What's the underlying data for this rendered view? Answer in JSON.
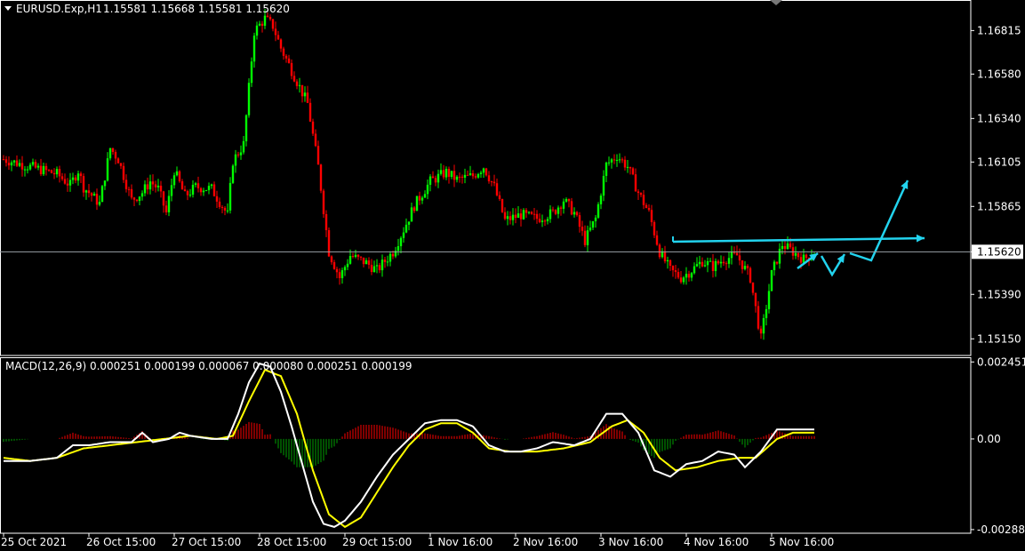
{
  "chart_data": {
    "type": "candlestick",
    "symbol_label": "EURUSD.Exp,H1",
    "ohlc_label": "1.15581 1.15668 1.15581 1.15620",
    "price_axis": {
      "ticks": [
        "1.16815",
        "1.16580",
        "1.16340",
        "1.16105",
        "1.15865",
        "1.15620",
        "1.15390",
        "1.15150"
      ],
      "current_price": "1.15620",
      "ylim": [
        1.1506,
        1.1698
      ]
    },
    "time_axis": {
      "ticks": [
        "25 Oct 2021",
        "26 Oct 15:00",
        "27 Oct 15:00",
        "28 Oct 15:00",
        "29 Oct 15:00",
        "1 Nov 16:00",
        "2 Nov 16:00",
        "3 Nov 16:00",
        "4 Nov 16:00",
        "5 Nov 16:00"
      ]
    },
    "price_path": [
      [
        0,
        1.1612
      ],
      [
        10,
        1.1608
      ],
      [
        20,
        1.1604
      ],
      [
        25,
        1.1598
      ],
      [
        28,
        1.1606
      ],
      [
        30,
        1.1597
      ],
      [
        36,
        1.1588
      ],
      [
        40,
        1.1618
      ],
      [
        43,
        1.1612
      ],
      [
        48,
        1.159
      ],
      [
        52,
        1.1594
      ],
      [
        55,
        1.16
      ],
      [
        58,
        1.1596
      ],
      [
        61,
        1.1583
      ],
      [
        64,
        1.1606
      ],
      [
        68,
        1.1592
      ],
      [
        72,
        1.1597
      ],
      [
        78,
        1.1596
      ],
      [
        84,
        1.1582
      ],
      [
        86,
        1.1611
      ],
      [
        90,
        1.162
      ],
      [
        94,
        1.1681
      ],
      [
        98,
        1.1688
      ],
      [
        101,
        1.1684
      ],
      [
        104,
        1.1672
      ],
      [
        110,
        1.1654
      ],
      [
        114,
        1.1642
      ],
      [
        118,
        1.1608
      ],
      [
        122,
        1.1562
      ],
      [
        126,
        1.1548
      ],
      [
        130,
        1.156
      ],
      [
        136,
        1.1556
      ],
      [
        140,
        1.1552
      ],
      [
        146,
        1.1562
      ],
      [
        150,
        1.1574
      ],
      [
        154,
        1.1587
      ],
      [
        160,
        1.16
      ],
      [
        166,
        1.1605
      ],
      [
        170,
        1.1601
      ],
      [
        176,
        1.1603
      ],
      [
        180,
        1.1608
      ],
      [
        184,
        1.1597
      ],
      [
        188,
        1.1579
      ],
      [
        194,
        1.1582
      ],
      [
        200,
        1.158
      ],
      [
        206,
        1.1583
      ],
      [
        210,
        1.159
      ],
      [
        214,
        1.1583
      ],
      [
        218,
        1.1568
      ],
      [
        222,
        1.158
      ],
      [
        226,
        1.1609
      ],
      [
        230,
        1.1614
      ],
      [
        234,
        1.1608
      ],
      [
        238,
        1.1594
      ],
      [
        242,
        1.1583
      ],
      [
        246,
        1.1562
      ],
      [
        250,
        1.1552
      ],
      [
        254,
        1.1548
      ],
      [
        258,
        1.1552
      ],
      [
        262,
        1.1557
      ],
      [
        266,
        1.1554
      ],
      [
        270,
        1.1558
      ],
      [
        275,
        1.156
      ],
      [
        280,
        1.1548
      ],
      [
        284,
        1.1515
      ],
      [
        288,
        1.155
      ],
      [
        292,
        1.1566
      ],
      [
        296,
        1.1562
      ],
      [
        300,
        1.1558
      ],
      [
        304,
        1.1562
      ]
    ],
    "forecast_arrows": "cyan",
    "colors": {
      "bull": "#00ff00",
      "bear": "#ff0000",
      "macd_line": "#ffffff",
      "signal_line": "#ffff00",
      "hist_pos": "#ff0000",
      "hist_neg": "#00a000",
      "arrows": "#22d3ee",
      "grid": "#ffffff"
    },
    "macd": {
      "label": "MACD(12,26,9) 0.000251 0.000199 0.000067 0.000080 0.000251 0.000199",
      "ticks": [
        "0.002451",
        "0.00",
        "-0.002884"
      ],
      "ylim": [
        -0.003,
        0.0026
      ],
      "macd_line": [
        [
          0,
          -0.0007
        ],
        [
          10,
          -0.0007
        ],
        [
          20,
          -0.0006
        ],
        [
          26,
          -0.0002
        ],
        [
          32,
          -0.0002
        ],
        [
          40,
          -0.0001
        ],
        [
          48,
          -0.0001
        ],
        [
          52,
          0.0002
        ],
        [
          56,
          -0.0001
        ],
        [
          62,
          0.0
        ],
        [
          66,
          0.0002
        ],
        [
          70,
          0.0001
        ],
        [
          78,
          0.0
        ],
        [
          84,
          0.0
        ],
        [
          88,
          0.0008
        ],
        [
          92,
          0.0018
        ],
        [
          96,
          0.0024
        ],
        [
          100,
          0.0023
        ],
        [
          104,
          0.0015
        ],
        [
          108,
          0.0004
        ],
        [
          112,
          -0.0008
        ],
        [
          116,
          -0.002
        ],
        [
          120,
          -0.0027
        ],
        [
          124,
          -0.0028
        ],
        [
          128,
          -0.0026
        ],
        [
          134,
          -0.002
        ],
        [
          140,
          -0.0012
        ],
        [
          146,
          -0.0005
        ],
        [
          152,
          0.0
        ],
        [
          158,
          0.0005
        ],
        [
          164,
          0.0006
        ],
        [
          170,
          0.0006
        ],
        [
          176,
          0.0004
        ],
        [
          182,
          -0.0002
        ],
        [
          188,
          -0.0004
        ],
        [
          194,
          -0.0004
        ],
        [
          200,
          -0.0003
        ],
        [
          206,
          -0.0001
        ],
        [
          214,
          -0.0002
        ],
        [
          220,
          0.0
        ],
        [
          226,
          0.0008
        ],
        [
          232,
          0.0008
        ],
        [
          238,
          0.0002
        ],
        [
          244,
          -0.001
        ],
        [
          250,
          -0.0012
        ],
        [
          256,
          -0.0008
        ],
        [
          262,
          -0.0007
        ],
        [
          268,
          -0.0004
        ],
        [
          274,
          -0.0005
        ],
        [
          278,
          -0.0009
        ],
        [
          284,
          -0.0004
        ],
        [
          290,
          0.0003
        ],
        [
          296,
          0.0003
        ],
        [
          304,
          0.0003
        ]
      ],
      "signal_line": [
        [
          0,
          -0.0006
        ],
        [
          10,
          -0.0007
        ],
        [
          20,
          -0.0006
        ],
        [
          30,
          -0.0003
        ],
        [
          40,
          -0.0002
        ],
        [
          50,
          -0.0001
        ],
        [
          60,
          0.0
        ],
        [
          70,
          0.0001
        ],
        [
          80,
          0.0
        ],
        [
          86,
          0.0001
        ],
        [
          92,
          0.0012
        ],
        [
          98,
          0.0022
        ],
        [
          104,
          0.002
        ],
        [
          110,
          0.0008
        ],
        [
          116,
          -0.001
        ],
        [
          122,
          -0.0024
        ],
        [
          128,
          -0.0028
        ],
        [
          134,
          -0.0025
        ],
        [
          140,
          -0.0017
        ],
        [
          146,
          -0.0009
        ],
        [
          152,
          -0.0002
        ],
        [
          158,
          0.0003
        ],
        [
          164,
          0.0005
        ],
        [
          170,
          0.0005
        ],
        [
          176,
          0.0002
        ],
        [
          182,
          -0.0003
        ],
        [
          190,
          -0.0004
        ],
        [
          200,
          -0.0004
        ],
        [
          210,
          -0.0003
        ],
        [
          220,
          -0.0001
        ],
        [
          228,
          0.0004
        ],
        [
          234,
          0.0006
        ],
        [
          240,
          0.0002
        ],
        [
          246,
          -0.0006
        ],
        [
          252,
          -0.001
        ],
        [
          260,
          -0.0009
        ],
        [
          268,
          -0.0007
        ],
        [
          276,
          -0.0006
        ],
        [
          282,
          -0.0006
        ],
        [
          290,
          0.0
        ],
        [
          296,
          0.0002
        ],
        [
          304,
          0.0002
        ]
      ]
    }
  }
}
